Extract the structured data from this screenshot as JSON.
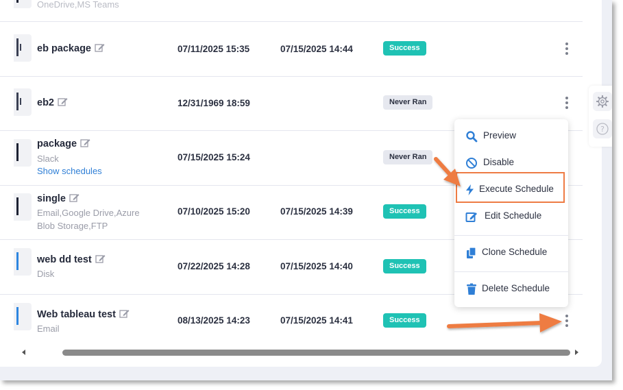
{
  "rows": [
    {
      "name": "",
      "sub1": "OneDrive,MS Teams",
      "sub2": "",
      "link": "",
      "created": "",
      "last_run": "",
      "status": ""
    },
    {
      "name": "eb package",
      "sub1": "",
      "sub2": "",
      "link": "",
      "created": "07/11/2025 15:35",
      "last_run": "07/15/2025 14:44",
      "status": "Success"
    },
    {
      "name": "eb2",
      "sub1": "",
      "sub2": "",
      "link": "",
      "created": "12/31/1969 18:59",
      "last_run": "",
      "status": "Never Ran"
    },
    {
      "name": "package",
      "sub1": "Slack",
      "sub2": "",
      "link": "Show schedules",
      "created": "07/15/2025 15:24",
      "last_run": "",
      "status": "Never Ran"
    },
    {
      "name": "single",
      "sub1": "Email,Google Drive,Azure",
      "sub2": "Blob Storage,FTP",
      "link": "",
      "created": "07/10/2025 15:20",
      "last_run": "07/15/2025 14:39",
      "status": "Success"
    },
    {
      "name": "web dd test",
      "sub1": "Disk",
      "sub2": "",
      "link": "",
      "created": "07/22/2025 14:28",
      "last_run": "07/15/2025 14:40",
      "status": "Success"
    },
    {
      "name": "Web tableau test",
      "sub1": "Email",
      "sub2": "",
      "link": "",
      "created": "08/13/2025 14:23",
      "last_run": "07/15/2025 14:41",
      "status": "Success"
    }
  ],
  "menu": {
    "preview": "Preview",
    "disable": "Disable",
    "execute": "Execute Schedule",
    "edit": "Edit Schedule",
    "clone": "Clone Schedule",
    "delete": "Delete Schedule"
  },
  "colors": {
    "success": "#1fc2b4",
    "never_ran": "#e6e8ef",
    "menu_icon": "#2f7fd6",
    "annotation": "#ee7b43"
  },
  "icons": [
    "file-icon",
    "edit-icon",
    "kebab-icon",
    "gear-icon",
    "help-icon",
    "search-icon",
    "ban-icon",
    "bolt-icon",
    "edit-square-icon",
    "copy-icon",
    "trash-icon"
  ]
}
